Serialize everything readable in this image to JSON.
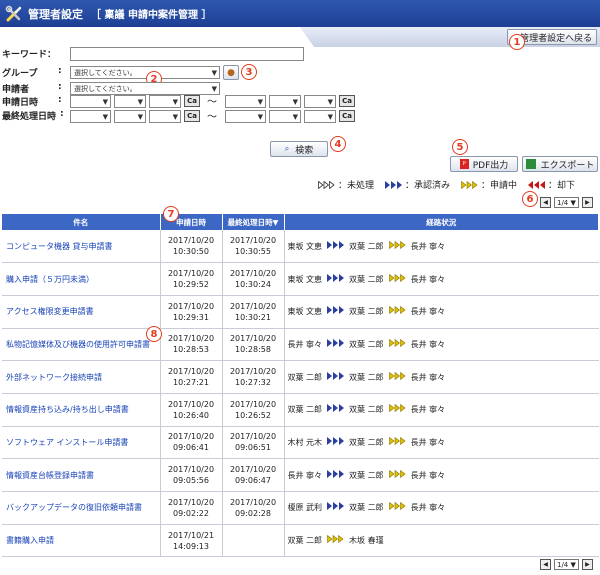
{
  "header": {
    "title": "管理者設定",
    "subtitle": "［ 稟議 申請中案件管理 ］"
  },
  "back_button_label": "管理者設定へ戻る",
  "form": {
    "keyword_label": "キーワード：",
    "group_label": "グループ",
    "group_colon": ":",
    "group_placeholder": "選択してください。",
    "applicant_label": "申請者",
    "applicant_colon": ":",
    "applicant_placeholder": "選択してください。",
    "apply_date_label": "申請日時",
    "apply_date_colon": ":",
    "last_date_label": "最終処理日時",
    "last_date_colon": ":",
    "cal_label": "Ca",
    "tilde": "〜",
    "search_button": "検索"
  },
  "badges": [
    "1",
    "2",
    "3",
    "4",
    "5",
    "6",
    "7",
    "8"
  ],
  "toolbar": {
    "pdf_button": "PDF出力",
    "export_button": "エクスポート"
  },
  "legend": {
    "unprocessed": "：未処理",
    "approved": "：承認済み",
    "in_progress": "：申請中",
    "rejected": "：却下"
  },
  "pager": {
    "value": "1/4"
  },
  "table": {
    "headers": {
      "name": "件名",
      "apply_date": "申請日時",
      "last_date": "最終処理日時▼",
      "route": "経路状況"
    },
    "rows": [
      {
        "name": "コンピュータ機器 貸与申請書",
        "d1": "2017/10/20",
        "t1": "10:30:50",
        "d2": "2017/10/20",
        "t2": "10:30:55",
        "p1": "東坂 文恵",
        "p2": "双葉 二郎",
        "p3": "長井 寧々"
      },
      {
        "name": "購入申請（５万円未満）",
        "d1": "2017/10/20",
        "t1": "10:29:52",
        "d2": "2017/10/20",
        "t2": "10:30:24",
        "p1": "東坂 文恵",
        "p2": "双葉 二郎",
        "p3": "長井 寧々"
      },
      {
        "name": "アクセス権限変更申請書",
        "d1": "2017/10/20",
        "t1": "10:29:31",
        "d2": "2017/10/20",
        "t2": "10:30:21",
        "p1": "東坂 文恵",
        "p2": "双葉 二郎",
        "p3": "長井 寧々"
      },
      {
        "name": "私物記憶媒体及び機器の使用許可申請書",
        "d1": "2017/10/20",
        "t1": "10:28:53",
        "d2": "2017/10/20",
        "t2": "10:28:58",
        "p1": "長井 寧々",
        "p2": "双葉 二郎",
        "p3": "長井 寧々"
      },
      {
        "name": "外部ネットワーク接続申請",
        "d1": "2017/10/20",
        "t1": "10:27:21",
        "d2": "2017/10/20",
        "t2": "10:27:32",
        "p1": "双葉 二郎",
        "p2": "双葉 二郎",
        "p3": "長井 寧々"
      },
      {
        "name": "情報資産持ち込み/持ち出し申請書",
        "d1": "2017/10/20",
        "t1": "10:26:40",
        "d2": "2017/10/20",
        "t2": "10:26:52",
        "p1": "双葉 二郎",
        "p2": "双葉 二郎",
        "p3": "長井 寧々"
      },
      {
        "name": "ソフトウェア インストール申請書",
        "d1": "2017/10/20",
        "t1": "09:06:41",
        "d2": "2017/10/20",
        "t2": "09:06:51",
        "p1": "木村 元木",
        "p2": "双葉 二郎",
        "p3": "長井 寧々"
      },
      {
        "name": "情報資産台帳登録申請書",
        "d1": "2017/10/20",
        "t1": "09:05:56",
        "d2": "2017/10/20",
        "t2": "09:06:47",
        "p1": "長井 寧々",
        "p2": "双葉 二郎",
        "p3": "長井 寧々"
      },
      {
        "name": "バックアップデータの復旧依頼申請書",
        "d1": "2017/10/20",
        "t1": "09:02:22",
        "d2": "2017/10/20",
        "t2": "09:02:28",
        "p1": "榎原 武利",
        "p2": "双葉 二郎",
        "p3": "長井 寧々"
      },
      {
        "name": "書籍購入申請",
        "d1": "2017/10/21",
        "t1": "14:09:13",
        "d2": "",
        "t2": "",
        "p1": "双葉 二郎",
        "p2": "木坂 春瑾",
        "p3": ""
      }
    ]
  }
}
